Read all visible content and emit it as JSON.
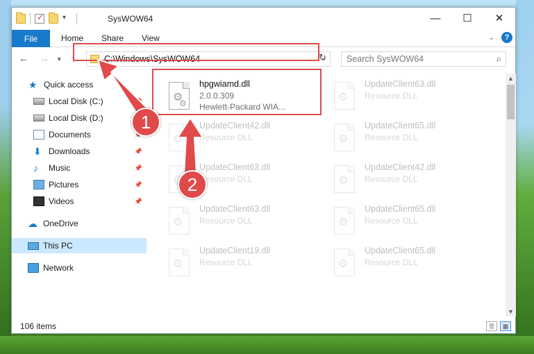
{
  "window": {
    "title": "SysWOW64",
    "controls": {
      "minimize": "—",
      "maximize": "☐",
      "close": "✕"
    }
  },
  "ribbon": {
    "tabs": [
      "File",
      "Home",
      "Share",
      "View"
    ],
    "help_icon": "?"
  },
  "nav": {
    "address": "C:\\Windows\\SysWOW64",
    "search_placeholder": "Search SysWOW64"
  },
  "sidebar": {
    "items": [
      {
        "label": "Quick access",
        "icon": "star-icon"
      },
      {
        "label": "Local Disk (C:)",
        "icon": "disk-icon",
        "pinned": true
      },
      {
        "label": "Local Disk (D:)",
        "icon": "disk-icon"
      },
      {
        "label": "Documents",
        "icon": "documents-icon",
        "pinned": true
      },
      {
        "label": "Downloads",
        "icon": "download-icon",
        "pinned": true
      },
      {
        "label": "Music",
        "icon": "music-icon",
        "pinned": true
      },
      {
        "label": "Pictures",
        "icon": "pictures-icon",
        "pinned": true
      },
      {
        "label": "Videos",
        "icon": "videos-icon",
        "pinned": true
      },
      {
        "label": "OneDrive",
        "icon": "onedrive-icon"
      },
      {
        "label": "This PC",
        "icon": "computer-icon",
        "selected": true
      },
      {
        "label": "Network",
        "icon": "network-icon"
      }
    ]
  },
  "files": {
    "highlighted": {
      "name": "hpgwiamd.dll",
      "version": "2.0.0.309",
      "company": "Hewlett-Packard WIA..."
    },
    "faded": [
      {
        "name": "UpdateClient63.dll",
        "type": "Resource DLL"
      },
      {
        "name": "UpdateClient42.dll",
        "type": "Resource DLL"
      },
      {
        "name": "UpdateClient65.dll",
        "type": "Resource DLL"
      },
      {
        "name": "UpdateClient63.dll",
        "type": "Resource DLL"
      },
      {
        "name": "UpdateClient42.dll",
        "type": "Resource DLL"
      },
      {
        "name": "UpdateClient63.dll",
        "type": "Resource DLL"
      },
      {
        "name": "UpdateClient65.dll",
        "type": "Resource DLL"
      },
      {
        "name": "UpdateClient19.dll",
        "type": "Resource DLL"
      },
      {
        "name": "UpdateClient65.dll",
        "type": "Resource DLL"
      }
    ]
  },
  "status": {
    "item_count": "106 items"
  },
  "annotations": {
    "step1": "1",
    "step2": "2"
  },
  "colors": {
    "accent": "#1979ca",
    "annotation_red": "#e04a4a",
    "selected_bg": "#cce8ff"
  }
}
